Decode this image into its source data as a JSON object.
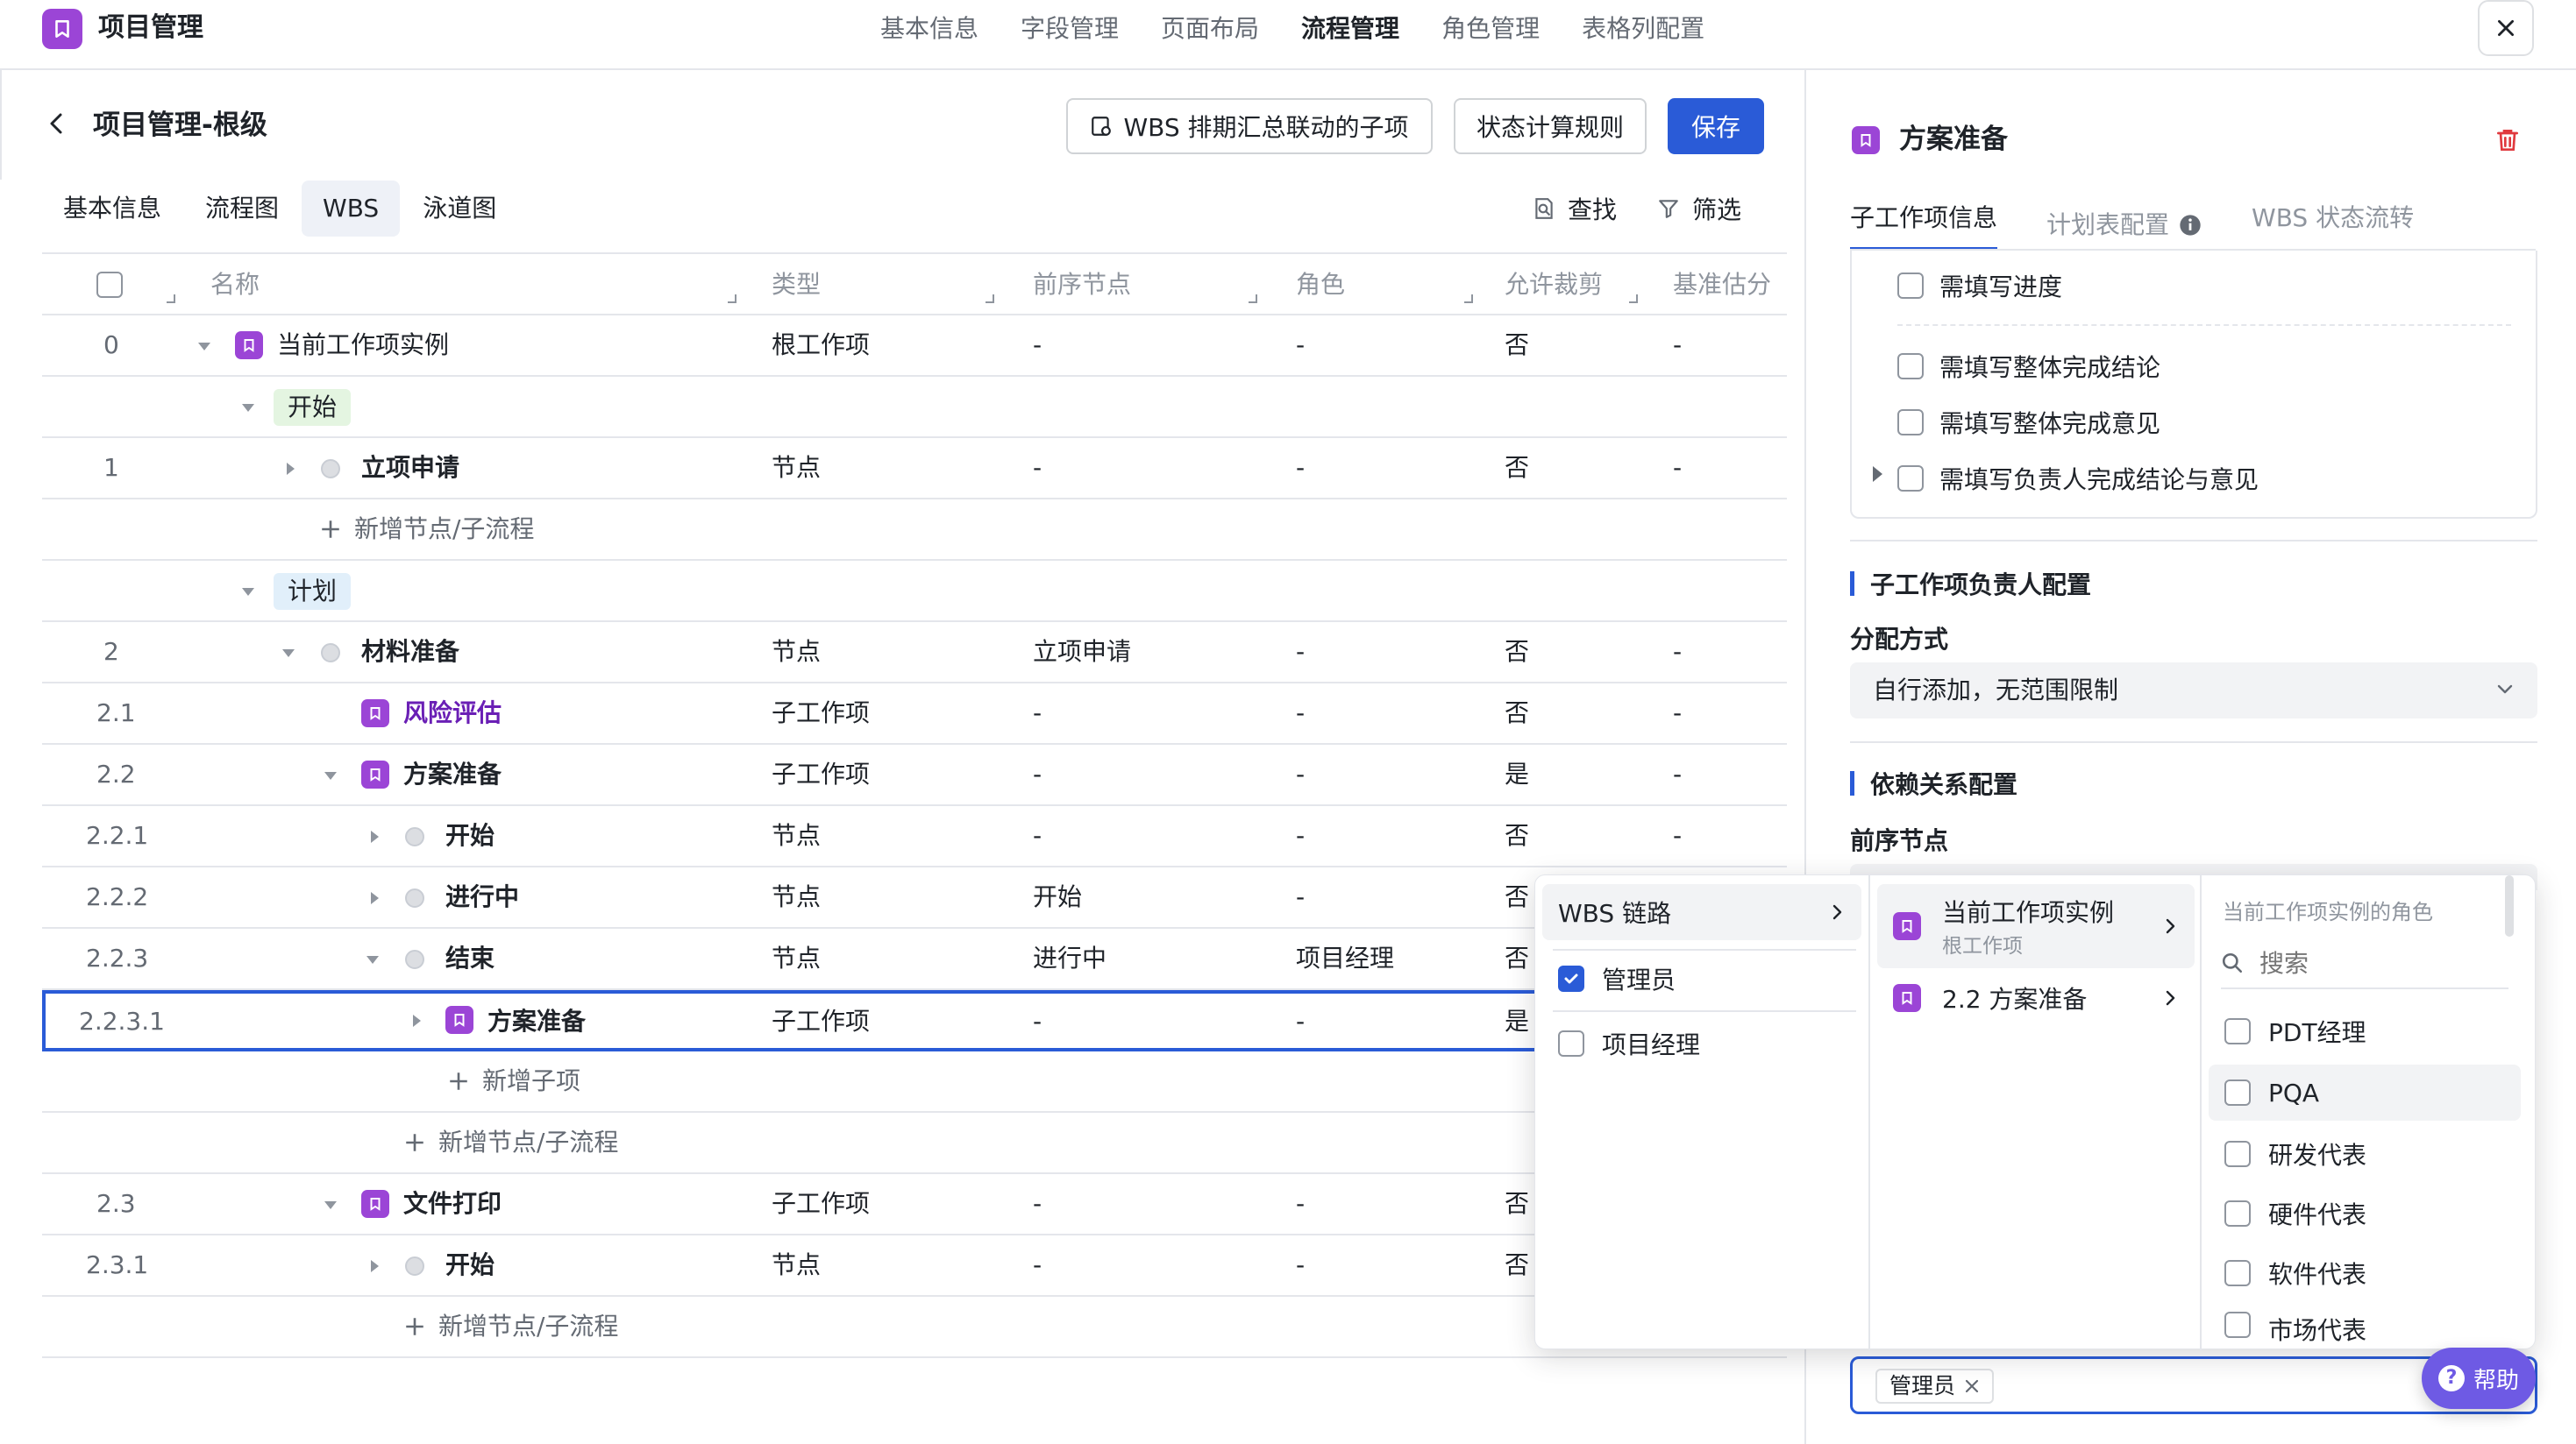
{
  "app": {
    "title": "项目管理"
  },
  "topnav": [
    "基本信息",
    "字段管理",
    "页面布局",
    "流程管理",
    "角色管理",
    "表格列配置"
  ],
  "topnav_active": "流程管理",
  "page": {
    "title": "项目管理-根级",
    "btn_wbs": "WBS 排期汇总联动的子项",
    "btn_rule": "状态计算规则",
    "btn_save": "保存"
  },
  "subtabs": [
    "基本信息",
    "流程图",
    "WBS",
    "泳道图"
  ],
  "subtab_active": "WBS",
  "tools": {
    "search": "查找",
    "filter": "筛选"
  },
  "table": {
    "headers": [
      "名称",
      "类型",
      "前序节点",
      "角色",
      "允许裁剪",
      "基准估分"
    ],
    "rows": [
      {
        "num": "0",
        "name": "当前工作项实例",
        "type": "根工作项",
        "prev": "-",
        "role": "-",
        "trim": "否",
        "est": "-"
      },
      {
        "stage": "开始"
      },
      {
        "num": "1",
        "name": "立项申请",
        "type": "节点",
        "prev": "-",
        "role": "-",
        "trim": "否",
        "est": "-"
      },
      {
        "add": "新增节点/子流程"
      },
      {
        "stage": "计划"
      },
      {
        "num": "2",
        "name": "材料准备",
        "type": "节点",
        "prev": "立项申请",
        "role": "-",
        "trim": "否",
        "est": "-"
      },
      {
        "num": "2.1",
        "name": "风险评估",
        "type": "子工作项",
        "prev": "-",
        "role": "-",
        "trim": "否",
        "est": "-"
      },
      {
        "num": "2.2",
        "name": "方案准备",
        "type": "子工作项",
        "prev": "-",
        "role": "-",
        "trim": "是",
        "est": "-"
      },
      {
        "num": "2.2.1",
        "name": "开始",
        "type": "节点",
        "prev": "-",
        "role": "-",
        "trim": "否",
        "est": "-"
      },
      {
        "num": "2.2.2",
        "name": "进行中",
        "type": "节点",
        "prev": "开始",
        "role": "-",
        "trim": "否"
      },
      {
        "num": "2.2.3",
        "name": "结束",
        "type": "节点",
        "prev": "进行中",
        "role": "项目经理",
        "trim": "否"
      },
      {
        "num": "2.2.3.1",
        "name": "方案准备",
        "type": "子工作项",
        "prev": "-",
        "role": "-",
        "trim": "是"
      },
      {
        "add": "新增子项"
      },
      {
        "add": "新增节点/子流程"
      },
      {
        "num": "2.3",
        "name": "文件打印",
        "type": "子工作项",
        "prev": "-",
        "role": "-",
        "trim": "否"
      },
      {
        "num": "2.3.1",
        "name": "开始",
        "type": "节点",
        "prev": "-",
        "role": "-",
        "trim": "否"
      },
      {
        "add": "新增节点/子流程"
      }
    ]
  },
  "right_panel": {
    "title": "方案准备",
    "tabs": [
      "子工作项信息",
      "计划表配置",
      "WBS 状态流转"
    ],
    "tab_active": "子工作项信息",
    "checks": [
      "需填写进度",
      "需填写整体完成结论",
      "需填写整体完成意见",
      "需填写负责人完成结论与意见"
    ],
    "section_owner": "子工作项负责人配置",
    "assign_label": "分配方式",
    "assign_value": "自行添加，无范围限制",
    "section_dep": "依赖关系配置",
    "pred_label": "前序节点",
    "tag_value": "管理员",
    "help": "帮助"
  },
  "popup": {
    "col1": {
      "chain": "WBS 链路",
      "options": [
        {
          "label": "管理员",
          "checked": true
        },
        {
          "label": "项目经理",
          "checked": false
        }
      ]
    },
    "col2": [
      {
        "label": "当前工作项实例",
        "sub": "根工作项"
      },
      {
        "label": "2.2 方案准备"
      }
    ],
    "col3": {
      "title": "当前工作项实例的角色",
      "search_placeholder": "搜索",
      "roles": [
        "PDT经理",
        "PQA",
        "研发代表",
        "硬件代表",
        "软件代表",
        "市场代表"
      ]
    }
  },
  "colors": {
    "accent": "#2a5bd7",
    "brand": "#9b45d6",
    "link": "#6a1fb5",
    "stage_start_bg": "#e4f5e1",
    "stage_plan_bg": "#e1effa"
  }
}
